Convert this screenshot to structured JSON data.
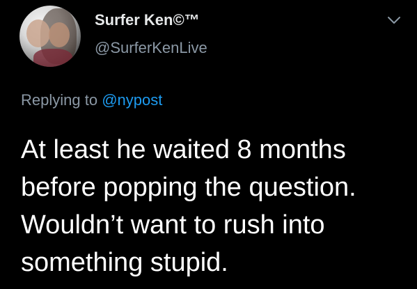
{
  "tweet": {
    "display_name": "Surfer Ken©™",
    "handle": "@SurferKenLive",
    "reply_prefix": "Replying to",
    "reply_to": "@nypost",
    "body_lines": [
      "At least he waited 8 months",
      "before popping the question.",
      "Wouldn’t want to rush into",
      "something stupid."
    ]
  },
  "icons": {
    "menu": "chevron-down-icon",
    "avatar": "profile-photo"
  },
  "colors": {
    "background": "#000000",
    "text_primary": "#ffffff",
    "text_secondary": "#8b98a5",
    "link": "#1d9bf0"
  }
}
